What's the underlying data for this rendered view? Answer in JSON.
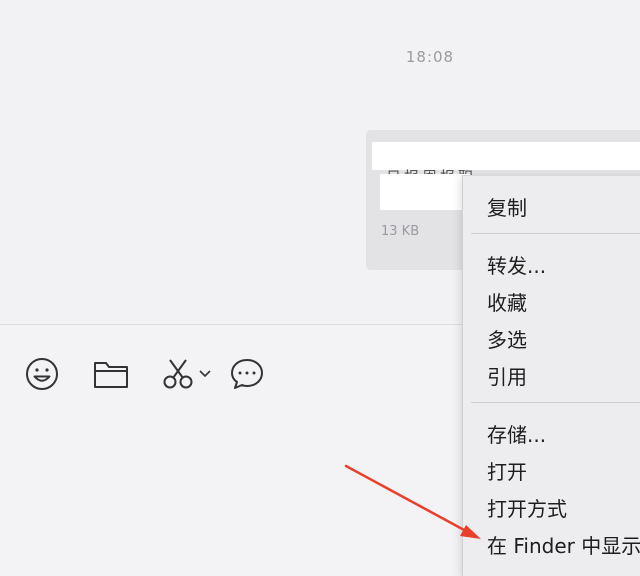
{
  "chat": {
    "timestamp": "18:08",
    "file": {
      "name": "日报周报职工管理",
      "size": "13 KB"
    }
  },
  "toolbar": {
    "items": [
      {
        "name": "emoji-icon"
      },
      {
        "name": "folder-icon"
      },
      {
        "name": "scissors-icon"
      },
      {
        "name": "chat-bubble-icon"
      }
    ]
  },
  "context_menu": {
    "items": [
      "复制",
      "转发...",
      "收藏",
      "多选",
      "引用",
      "存储...",
      "打开",
      "打开方式",
      "在 Finder 中显示"
    ]
  },
  "annotation": {
    "arrow_color": "#e8402a"
  }
}
